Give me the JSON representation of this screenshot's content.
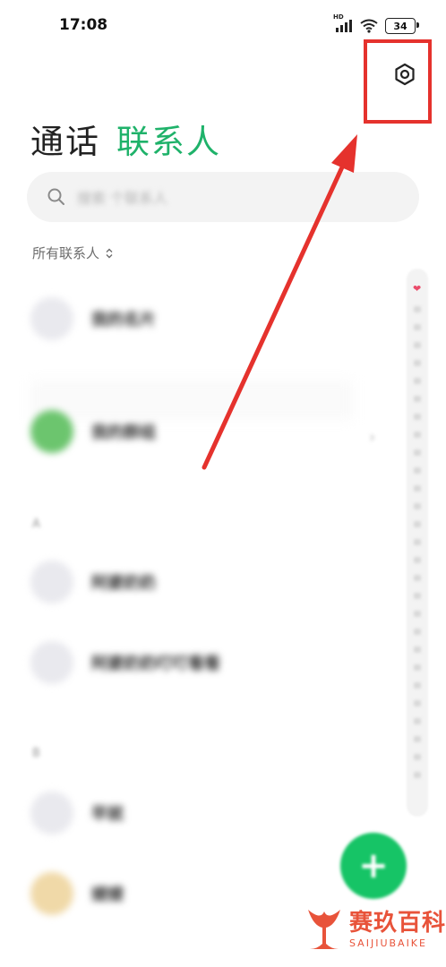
{
  "status_bar": {
    "time": "17:08",
    "battery": "34",
    "network_badge": "HD",
    "icons": [
      "signal-icon",
      "wifi-icon",
      "battery-icon"
    ]
  },
  "header": {
    "tabs": [
      {
        "label": "通话",
        "active": false
      },
      {
        "label": "联系人",
        "active": true
      }
    ],
    "settings_icon": "settings-hexagon-icon"
  },
  "search": {
    "placeholder": "搜索 个联系人"
  },
  "filter": {
    "label": "所有联系人",
    "icon": "sort-updown-icon"
  },
  "contacts": [
    {
      "label": "我的名片"
    },
    {
      "label": "我的群组"
    },
    {
      "label": "阿婆奶奶"
    },
    {
      "label": "阿婆奶奶叮叮看看"
    },
    {
      "label": "早就"
    },
    {
      "label": "嫂嫂"
    }
  ],
  "fab": {
    "icon": "plus-icon"
  },
  "annotation": {
    "color": "#e5322d"
  },
  "colors": {
    "accent": "#1fb26a",
    "fab": "#16c466"
  },
  "watermark": {
    "cn": "赛玖百科",
    "en": "SAIJIUBAIKE"
  }
}
